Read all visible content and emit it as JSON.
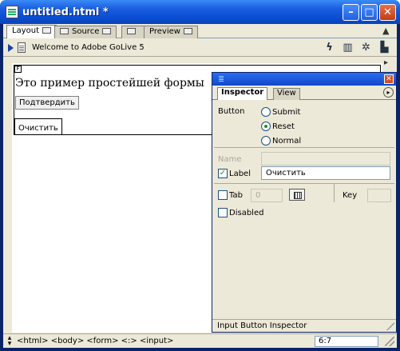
{
  "window": {
    "title": "untitled.html *",
    "controls": {
      "minimize": "–",
      "maximize": "□",
      "close": "✕"
    }
  },
  "tabs": [
    {
      "label": "Layout",
      "active": true
    },
    {
      "label": "Source",
      "active": false
    },
    {
      "label": "",
      "active": false
    },
    {
      "label": "Preview",
      "active": false
    }
  ],
  "toolbar": {
    "page_title": "Welcome to Adobe GoLive 5",
    "icons": [
      "play-icon",
      "page-icon",
      "lightning-icon",
      "frame-icon",
      "globe-gear-icon",
      "site-icon"
    ]
  },
  "document": {
    "form_text": "Это пример простейшей формы",
    "submit_label": "Подтвердить",
    "reset_label": "Очистить"
  },
  "statusbar": {
    "tags": "<html> <body> <form> <:> <input>",
    "zoom": "6:7"
  },
  "inspector": {
    "tabs": [
      "Inspector",
      "View"
    ],
    "button_label": "Button",
    "button_types": [
      {
        "label": "Submit",
        "selected": false
      },
      {
        "label": "Reset",
        "selected": true
      },
      {
        "label": "Normal",
        "selected": false
      }
    ],
    "name_label": "Name",
    "name_value": "",
    "label_checkbox": "Label",
    "label_checked": true,
    "label_value": "Очистить",
    "tab_label": "Tab",
    "tab_checked": false,
    "tab_value": "0",
    "key_label": "Key",
    "key_value": "",
    "disabled_label": "Disabled",
    "disabled_checked": false,
    "footer": "Input Button Inspector"
  }
}
